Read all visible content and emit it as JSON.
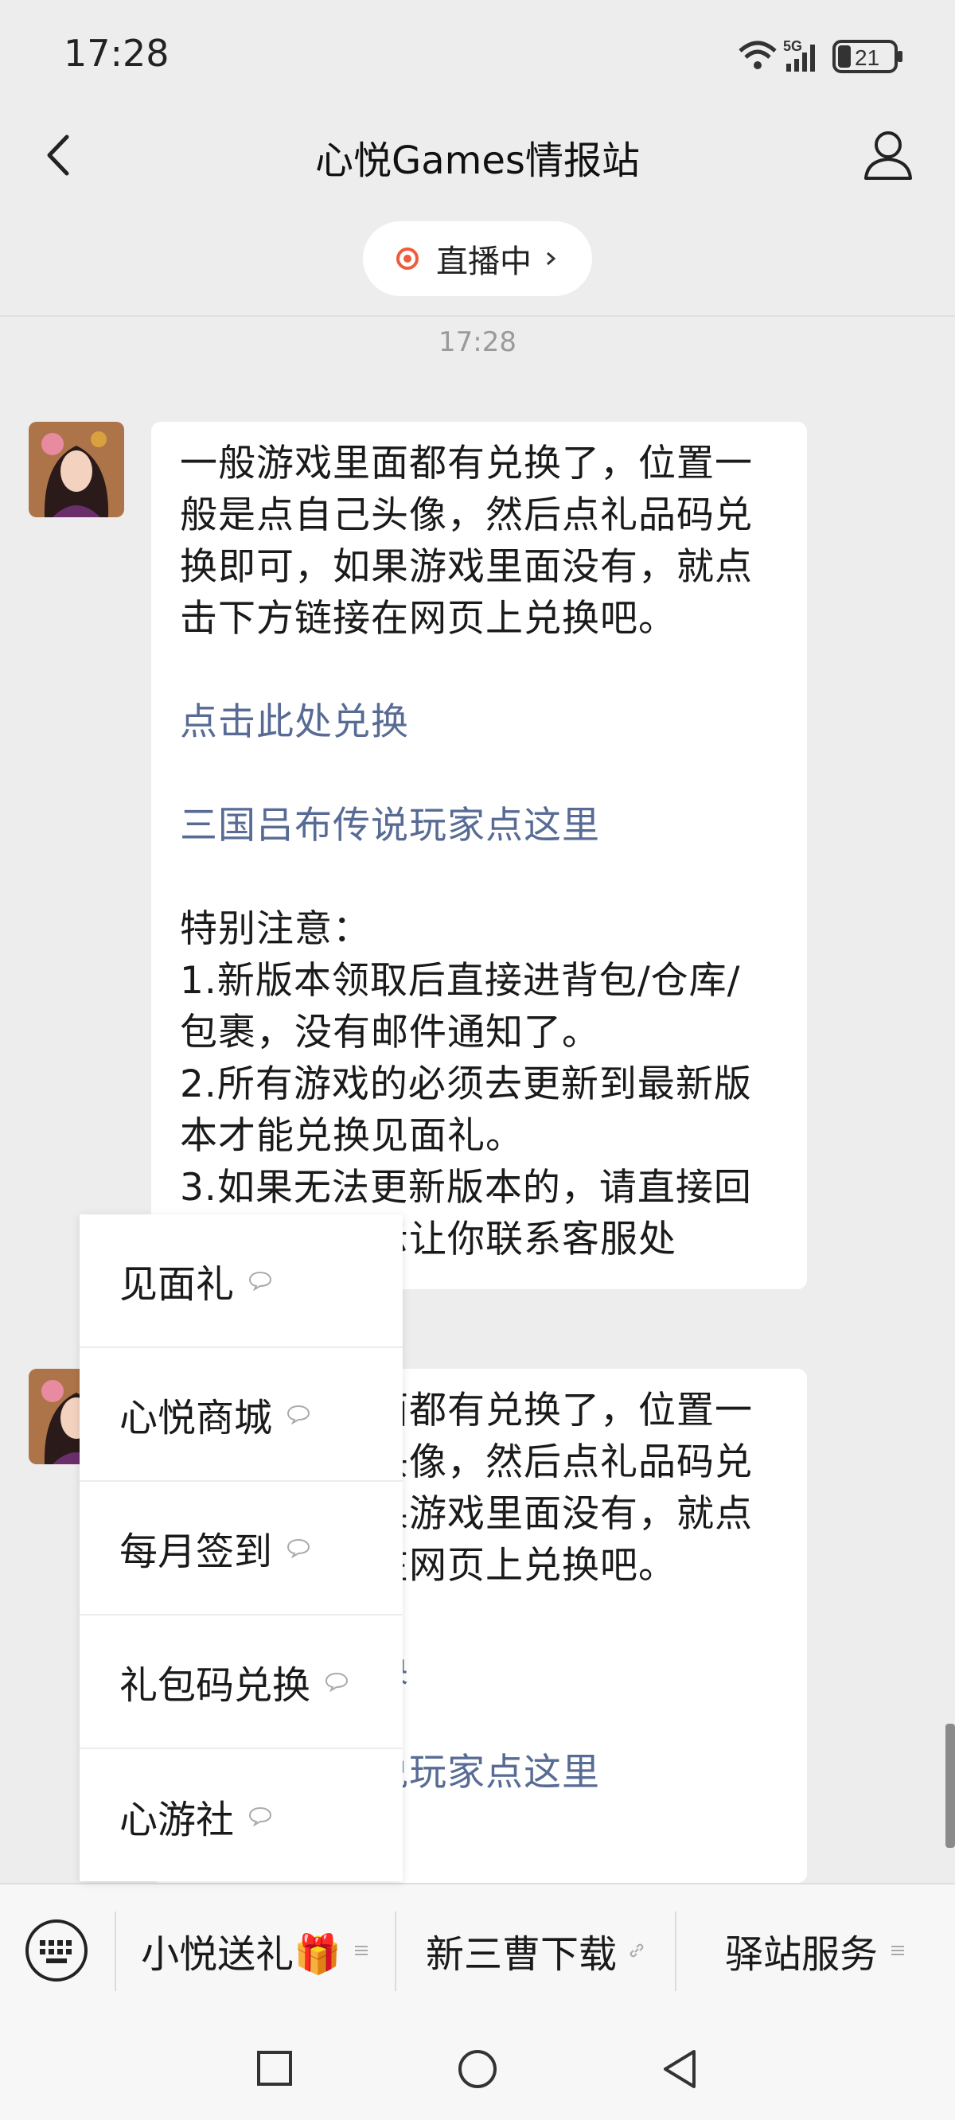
{
  "status_bar": {
    "time": "17:28",
    "network": "5G",
    "battery": "21"
  },
  "header": {
    "title": "心悦Games情报站"
  },
  "live": {
    "label": "直播中"
  },
  "chat": {
    "timestamp": "17:28",
    "message": {
      "paragraph1": "一般游戏里面都有兑换了，位置一般是点自己头像，然后点礼品码兑换即可，如果游戏里面没有，就点击下方链接在网页上兑换吧。",
      "link1": "点击此处兑换",
      "link2": "三国吕布传说玩家点这里",
      "note_title": "特别注意：",
      "note1": "1.新版本领取后直接进背包/仓库/包裹，没有邮件通知了。",
      "note2": "2.所有游戏的必须去更新到最新版本才能兑换见面礼。",
      "note3": "3.如果无法更新版本的，请直接回复，若有提示让你联系客服处"
    }
  },
  "popup_menu": {
    "items": [
      {
        "label": "见面礼"
      },
      {
        "label": "心悦商城"
      },
      {
        "label": "每月签到"
      },
      {
        "label": "礼包码兑换"
      },
      {
        "label": "心游社"
      }
    ]
  },
  "bottom_menu": {
    "items": [
      {
        "label": "小悦送礼🎁"
      },
      {
        "label": "新三曹下载"
      },
      {
        "label": "驿站服务"
      }
    ]
  },
  "colors": {
    "background": "#ededed",
    "link": "#576b95",
    "live_dot": "#f05b3c",
    "bubble": "#ffffff"
  }
}
